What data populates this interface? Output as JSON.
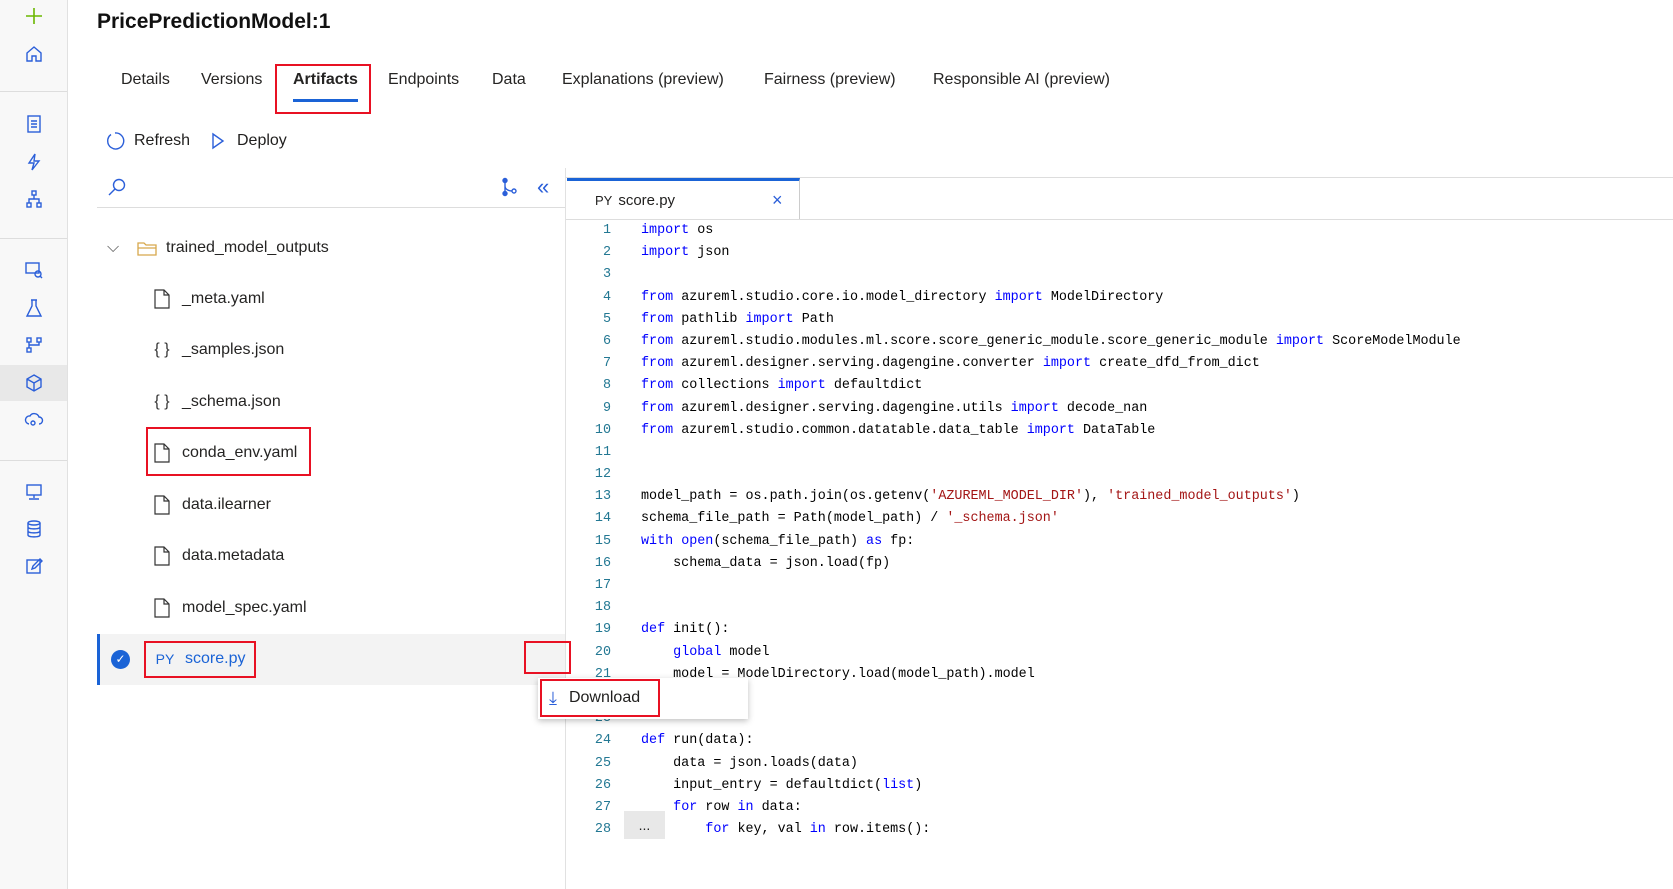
{
  "rail": {
    "icons": [
      "plus-icon",
      "home-icon",
      "notebook-icon",
      "automl-icon",
      "designer-icon",
      "datasets-icon",
      "experiments-icon",
      "pipelines-icon",
      "models-icon",
      "endpoints-icon",
      "compute-icon",
      "datastores-icon",
      "labeling-icon"
    ]
  },
  "title": "PricePredictionModel:1",
  "tabs": [
    "Details",
    "Versions",
    "Artifacts",
    "Endpoints",
    "Data",
    "Explanations (preview)",
    "Fairness (preview)",
    "Responsible AI (preview)"
  ],
  "toolbar": {
    "refresh": "Refresh",
    "deploy": "Deploy"
  },
  "tree": {
    "folder": "trained_model_outputs",
    "files": [
      {
        "name": "_meta.yaml",
        "icon": "yaml-file-icon"
      },
      {
        "name": "_samples.json",
        "icon": "json-icon"
      },
      {
        "name": "_schema.json",
        "icon": "json-icon"
      },
      {
        "name": "conda_env.yaml",
        "icon": "yaml-file-icon"
      },
      {
        "name": "data.ilearner",
        "icon": "file-icon"
      },
      {
        "name": "data.metadata",
        "icon": "file-icon"
      },
      {
        "name": "model_spec.yaml",
        "icon": "yaml-file-icon"
      },
      {
        "name": "score.py",
        "icon": "PY"
      }
    ],
    "more": "..."
  },
  "menu": {
    "download": "Download"
  },
  "editor": {
    "tab_prefix": "PY",
    "tab_name": "score.py",
    "close": "×",
    "lines": [
      [
        [
          "k",
          "import"
        ],
        [
          "t",
          " os"
        ]
      ],
      [
        [
          "k",
          "import"
        ],
        [
          "t",
          " json"
        ]
      ],
      [],
      [
        [
          "k",
          "from"
        ],
        [
          "t",
          " azureml.studio.core.io.model_directory "
        ],
        [
          "k",
          "import"
        ],
        [
          "t",
          " ModelDirectory"
        ]
      ],
      [
        [
          "k",
          "from"
        ],
        [
          "t",
          " pathlib "
        ],
        [
          "k",
          "import"
        ],
        [
          "t",
          " Path"
        ]
      ],
      [
        [
          "k",
          "from"
        ],
        [
          "t",
          " azureml.studio.modules.ml.score.score_generic_module.score_generic_module "
        ],
        [
          "k",
          "import"
        ],
        [
          "t",
          " ScoreModelModule"
        ]
      ],
      [
        [
          "k",
          "from"
        ],
        [
          "t",
          " azureml.designer.serving.dagengine.converter "
        ],
        [
          "k",
          "import"
        ],
        [
          "t",
          " create_dfd_from_dict"
        ]
      ],
      [
        [
          "k",
          "from"
        ],
        [
          "t",
          " collections "
        ],
        [
          "k",
          "import"
        ],
        [
          "t",
          " defaultdict"
        ]
      ],
      [
        [
          "k",
          "from"
        ],
        [
          "t",
          " azureml.designer.serving.dagengine.utils "
        ],
        [
          "k",
          "import"
        ],
        [
          "t",
          " decode_nan"
        ]
      ],
      [
        [
          "k",
          "from"
        ],
        [
          "t",
          " azureml.studio.common.datatable.data_table "
        ],
        [
          "k",
          "import"
        ],
        [
          "t",
          " DataTable"
        ]
      ],
      [],
      [],
      [
        [
          "t",
          "model_path = os.path.join(os.getenv("
        ],
        [
          "s",
          "'AZUREML_MODEL_DIR'"
        ],
        [
          "t",
          "), "
        ],
        [
          "s",
          "'trained_model_outputs'"
        ],
        [
          "t",
          ")"
        ]
      ],
      [
        [
          "t",
          "schema_file_path = Path(model_path) / "
        ],
        [
          "s",
          "'_schema.json'"
        ]
      ],
      [
        [
          "k",
          "with"
        ],
        [
          "t",
          " "
        ],
        [
          "k",
          "open"
        ],
        [
          "t",
          "(schema_file_path) "
        ],
        [
          "k",
          "as"
        ],
        [
          "t",
          " fp:"
        ]
      ],
      [
        [
          "t",
          "    schema_data = json.load(fp)"
        ]
      ],
      [],
      [],
      [
        [
          "k",
          "def"
        ],
        [
          "t",
          " init():"
        ]
      ],
      [
        [
          "t",
          "    "
        ],
        [
          "k",
          "global"
        ],
        [
          "t",
          " model"
        ]
      ],
      [
        [
          "t",
          "    model = ModelDirectory.load(model_path).model"
        ]
      ],
      [],
      [],
      [
        [
          "k",
          "def"
        ],
        [
          "t",
          " run(data):"
        ]
      ],
      [
        [
          "t",
          "    data = json.loads(data)"
        ]
      ],
      [
        [
          "t",
          "    input_entry = defaultdict("
        ],
        [
          "k",
          "list"
        ],
        [
          "t",
          ")"
        ]
      ],
      [
        [
          "t",
          "    "
        ],
        [
          "k",
          "for"
        ],
        [
          "t",
          " row "
        ],
        [
          "k",
          "in"
        ],
        [
          "t",
          " data:"
        ]
      ],
      [
        [
          "t",
          "        "
        ],
        [
          "k",
          "for"
        ],
        [
          "t",
          " key, val "
        ],
        [
          "k",
          "in"
        ],
        [
          "t",
          " row.items():"
        ]
      ]
    ]
  }
}
